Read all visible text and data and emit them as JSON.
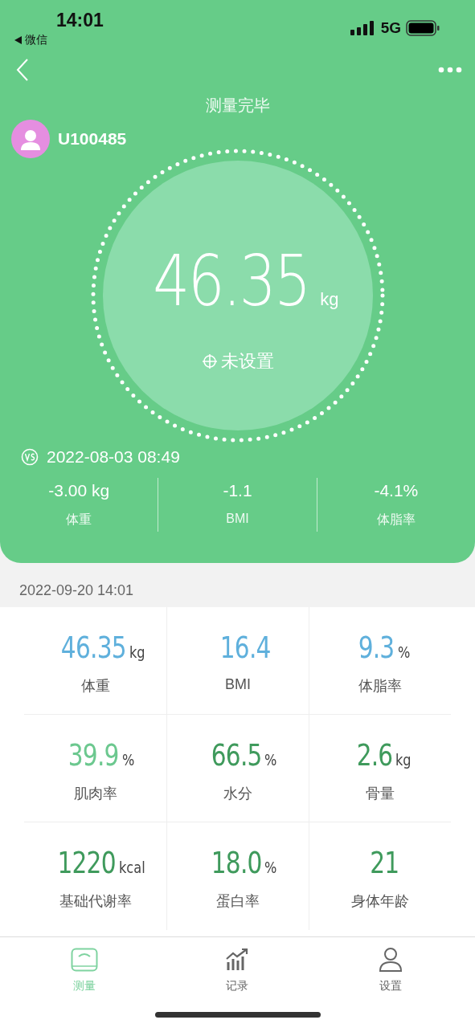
{
  "status_bar": {
    "time": "14:01",
    "back_app": "微信",
    "network": "5G"
  },
  "header": {
    "title": "测量完毕",
    "user_id": "U100485"
  },
  "result": {
    "weight": "46.35",
    "unit": "kg",
    "goal": "未设置"
  },
  "compare": {
    "date": "2022-08-03 08:49",
    "items": [
      {
        "value": "-3.00 kg",
        "label": "体重"
      },
      {
        "value": "-1.1",
        "label": "BMI"
      },
      {
        "value": "-4.1%",
        "label": "体脂率"
      }
    ]
  },
  "record_date": "2022-09-20 14:01",
  "metrics": [
    {
      "value": "46.35",
      "unit": "kg",
      "label": "体重",
      "color": "#5fb0dc"
    },
    {
      "value": "16.4",
      "label": "BMI",
      "color": "#5fb0dc"
    },
    {
      "value": "9.3",
      "unit": "%",
      "label": "体脂率",
      "color": "#5fb0dc"
    },
    {
      "value": "39.9",
      "unit": "%",
      "label": "肌肉率",
      "color": "#6cc88f"
    },
    {
      "value": "66.5",
      "unit": "%",
      "label": "水分",
      "color": "#3f9a5c"
    },
    {
      "value": "2.6",
      "unit": "kg",
      "label": "骨量",
      "color": "#3f9a5c"
    },
    {
      "value": "1220",
      "unit": "kcal",
      "label": "基础代谢率",
      "color": "#3f9a5c"
    },
    {
      "value": "18.0",
      "unit": "%",
      "label": "蛋白率",
      "color": "#3f9a5c"
    },
    {
      "value": "21",
      "label": "身体年龄",
      "color": "#3f9a5c"
    }
  ],
  "tabs": [
    {
      "kind": "scale",
      "label": "测量",
      "selected": true
    },
    {
      "kind": "chart",
      "label": "记录",
      "selected": false
    },
    {
      "kind": "person",
      "label": "设置",
      "selected": false
    }
  ]
}
